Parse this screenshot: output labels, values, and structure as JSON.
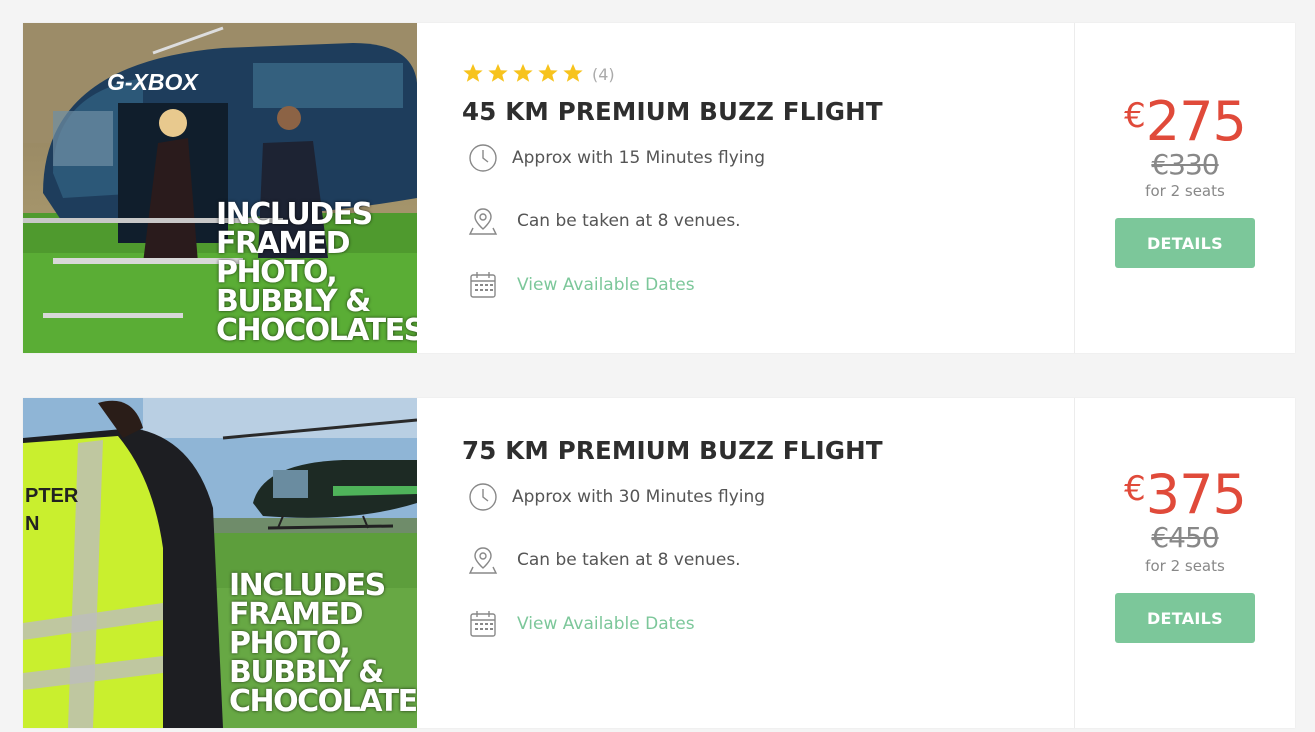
{
  "listings": [
    {
      "image": {
        "description_icon": "helicopter-photo-icon",
        "registration": "G-XBOX",
        "overlay_lines": [
          "INCLUDES",
          "FRAMED",
          "PHOTO,",
          "BUBBLY &",
          "CHOCOLATES"
        ]
      },
      "rating": {
        "stars": 5,
        "count": "(4)"
      },
      "title": "45 KM PREMIUM BUZZ FLIGHT",
      "features": {
        "time": "Approx with 15 Minutes flying",
        "venues": "Can be taken at 8 venues.",
        "dates": "View Available Dates"
      },
      "price": {
        "currency": "€",
        "amount": "275",
        "old": "€330",
        "seats": "for 2 seats"
      },
      "button": "DETAILS"
    },
    {
      "image": {
        "description_icon": "helicopter-photo-icon",
        "vest_lines": [
          "PTER",
          "N"
        ],
        "overlay_lines": [
          "INCLUDES",
          "FRAMED",
          "PHOTO,",
          "BUBBLY &",
          "CHOCOLATES"
        ]
      },
      "title": "75 KM PREMIUM BUZZ FLIGHT",
      "features": {
        "time": "Approx with 30 Minutes flying",
        "venues": "Can be taken at 8 venues.",
        "dates": "View Available Dates"
      },
      "price": {
        "currency": "€",
        "amount": "375",
        "old": "€450",
        "seats": "for 2 seats"
      },
      "button": "DETAILS"
    }
  ],
  "colors": {
    "accent_green": "#7cc79a",
    "price_red": "#e04a3a",
    "star_yellow": "#f7c31d"
  }
}
